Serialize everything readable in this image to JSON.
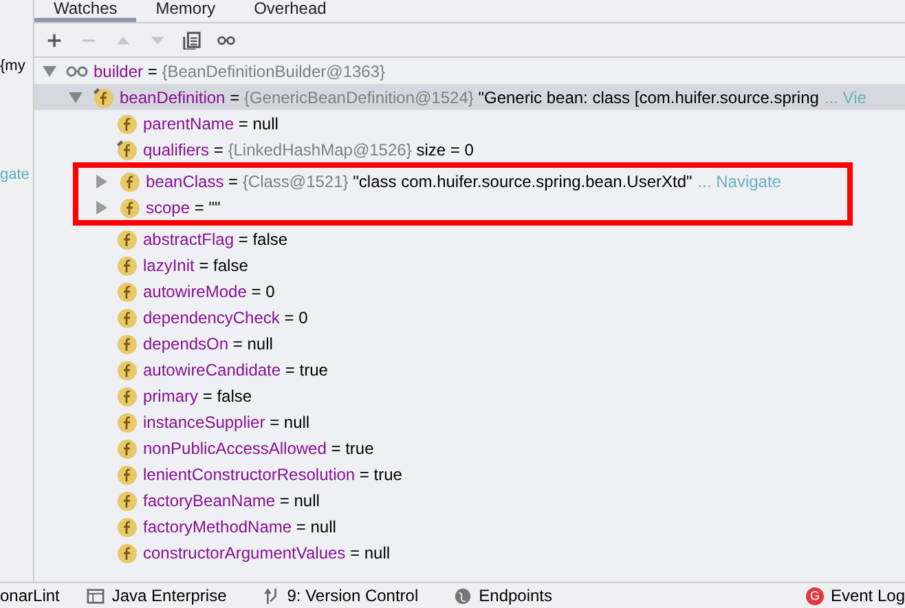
{
  "tabs": [
    {
      "label": "Watches",
      "selected": true
    },
    {
      "label": "Memory",
      "selected": false
    },
    {
      "label": "Overhead",
      "selected": false
    }
  ],
  "left_strip": [
    "{my",
    "gate"
  ],
  "toolbar": [
    {
      "kind": "add",
      "disabled": false
    },
    {
      "kind": "remove",
      "disabled": true
    },
    {
      "kind": "up",
      "disabled": true
    },
    {
      "kind": "down",
      "disabled": true
    },
    {
      "kind": "copy",
      "disabled": false
    },
    {
      "kind": "watch",
      "disabled": false
    }
  ],
  "tree": [
    {
      "kind": "watch",
      "name": "builder",
      "sep": "=",
      "type": "{BeanDefinitionBuilder@1363}",
      "expanded": true,
      "selected": false,
      "annotated": false,
      "children": [
        {
          "kind": "field-final",
          "name": "beanDefinition",
          "sep": "=",
          "type": "{GenericBeanDefinition@1524}",
          "value": "\"Generic bean: class [com.huifer.source.spring",
          "link": "... Vie",
          "expanded": true,
          "selected": true,
          "annotated": false,
          "children": [
            {
              "kind": "field",
              "name": "parentName",
              "sep": "=",
              "value": "null",
              "selected": false,
              "annotated": false
            },
            {
              "kind": "field-final",
              "name": "qualifiers",
              "sep": "=",
              "type": "{LinkedHashMap@1526}",
              "value": "size = 0",
              "selected": false,
              "annotated": false
            },
            {
              "kind": "field",
              "name": "beanClass",
              "sep": "=",
              "type": "{Class@1521}",
              "value": "\"class com.huifer.source.spring.bean.UserXtd\"",
              "link": "... Navigate",
              "expanded": false,
              "selected": false,
              "annotated": true
            },
            {
              "kind": "field",
              "name": "scope",
              "sep": "=",
              "value": "\"\"",
              "expanded": false,
              "selected": false,
              "annotated": true
            },
            {
              "kind": "field",
              "name": "abstractFlag",
              "sep": "=",
              "value": "false",
              "selected": false,
              "annotated": false
            },
            {
              "kind": "field",
              "name": "lazyInit",
              "sep": "=",
              "value": "false",
              "selected": false,
              "annotated": false
            },
            {
              "kind": "field",
              "name": "autowireMode",
              "sep": "=",
              "value": "0",
              "selected": false,
              "annotated": false
            },
            {
              "kind": "field",
              "name": "dependencyCheck",
              "sep": "=",
              "value": "0",
              "selected": false,
              "annotated": false
            },
            {
              "kind": "field",
              "name": "dependsOn",
              "sep": "=",
              "value": "null",
              "selected": false,
              "annotated": false
            },
            {
              "kind": "field",
              "name": "autowireCandidate",
              "sep": "=",
              "value": "true",
              "selected": false,
              "annotated": false
            },
            {
              "kind": "field",
              "name": "primary",
              "sep": "=",
              "value": "false",
              "selected": false,
              "annotated": false
            },
            {
              "kind": "field",
              "name": "instanceSupplier",
              "sep": "=",
              "value": "null",
              "selected": false,
              "annotated": false
            },
            {
              "kind": "field",
              "name": "nonPublicAccessAllowed",
              "sep": "=",
              "value": "true",
              "selected": false,
              "annotated": false
            },
            {
              "kind": "field",
              "name": "lenientConstructorResolution",
              "sep": "=",
              "value": "true",
              "selected": false,
              "annotated": false
            },
            {
              "kind": "field",
              "name": "factoryBeanName",
              "sep": "=",
              "value": "null",
              "selected": false,
              "annotated": false
            },
            {
              "kind": "field",
              "name": "factoryMethodName",
              "sep": "=",
              "value": "null",
              "selected": false,
              "annotated": false
            },
            {
              "kind": "field",
              "name": "constructorArgumentValues",
              "sep": "=",
              "value": "null",
              "selected": false,
              "annotated": false
            }
          ]
        }
      ]
    }
  ],
  "status_bar": [
    {
      "kind": "sonar",
      "label": "onarLint"
    },
    {
      "kind": "java",
      "label": "Java Enterprise"
    },
    {
      "kind": "vcs",
      "label": "9: Version Control"
    },
    {
      "kind": "globe",
      "label": "Endpoints"
    },
    {
      "kind": "event",
      "label": "Event Log",
      "badge": "G"
    }
  ]
}
